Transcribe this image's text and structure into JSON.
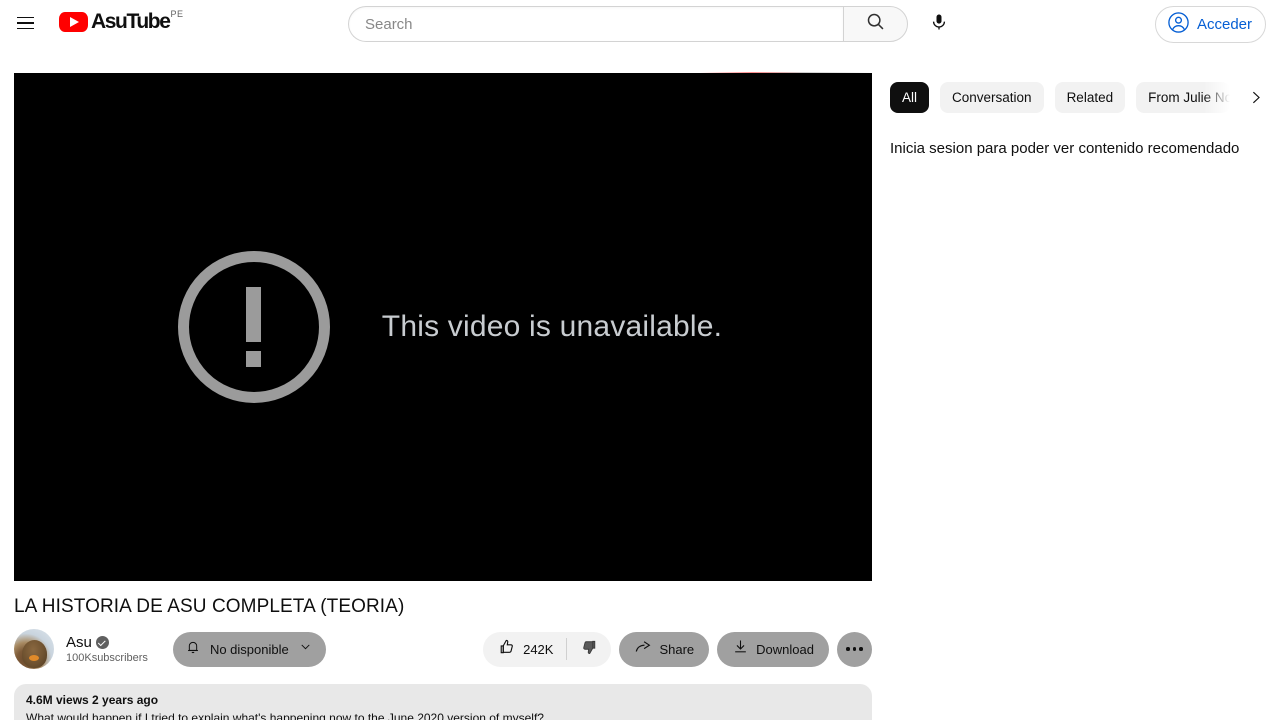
{
  "header": {
    "menu_icon": "hamburger-icon",
    "logo_text": "AsuTube",
    "logo_superscript": "PE",
    "logo_icon": "youtube-play-icon",
    "search": {
      "placeholder": "Search",
      "value": "",
      "button_icon": "search-icon"
    },
    "mic_icon": "microphone-icon",
    "signin": {
      "label": "Acceder",
      "icon": "account-circle-icon",
      "color": "#065fd4"
    }
  },
  "player": {
    "message": "This video is unavailable.",
    "icon": "alert-circle-exclamation-icon",
    "background": "#000000",
    "icon_color": "#9b9b9b",
    "text_color": "#c8ccd0"
  },
  "video": {
    "title": "LA HISTORIA DE ASU COMPLETA (TEORIA)",
    "channel": {
      "name": "Asu",
      "verified_icon": "verified-badge-icon",
      "subscribers": "100Ksubscribers",
      "avatar_icon": "channel-avatar-marmot"
    },
    "subscribe_button": {
      "label": "No disponible",
      "bell_icon": "bell-icon",
      "chevron_icon": "chevron-down-icon",
      "background": "#a0a0a0"
    },
    "actions": {
      "like": {
        "label": "242K",
        "icon": "thumb-up-icon"
      },
      "dislike": {
        "label": "",
        "icon": "thumb-down-icon"
      },
      "share": {
        "label": "Share",
        "icon": "share-arrow-icon"
      },
      "download": {
        "label": "Download",
        "icon": "download-icon"
      },
      "more": {
        "label": "",
        "icon": "more-horizontal-icon"
      }
    },
    "description": {
      "views": "4.6M views",
      "published": "2 years ago",
      "meta": "4.6M views  2 years ago",
      "body": "What would happen if I tried to explain what's happening now to the  June 2020 version of myself?"
    }
  },
  "sidebar": {
    "chips": [
      {
        "label": "All",
        "active": true
      },
      {
        "label": "Conversation",
        "active": false
      },
      {
        "label": "Related",
        "active": false
      },
      {
        "label": "From Julie Nolke",
        "active": false,
        "truncated": true
      }
    ],
    "next_icon": "chevron-right-icon",
    "note": "Inicia sesion para poder ver contenido recomendado"
  }
}
